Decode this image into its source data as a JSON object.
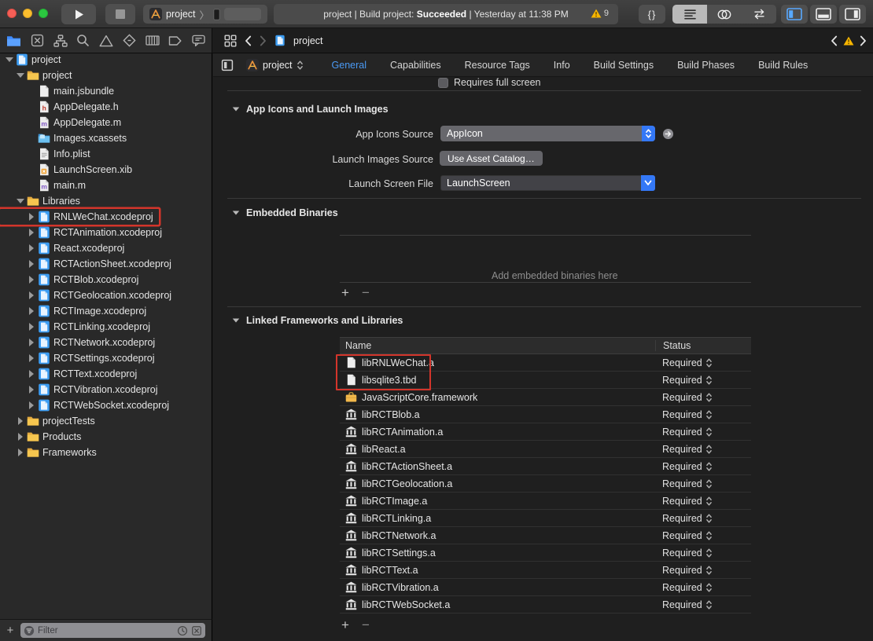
{
  "titlebar": {
    "scheme_label": "project",
    "status_left": "project | Build project: ",
    "status_bold": "Succeeded",
    "status_right": " | Yesterday at 11:38 PM",
    "warning_count": "9",
    "brace_label": "{}"
  },
  "navigator": {
    "items": [
      {
        "name": "project-navigator-icon",
        "icon": "nav-folder",
        "active": true
      },
      {
        "name": "source-control-navigator-icon",
        "icon": "nav-boxx"
      },
      {
        "name": "symbol-navigator-icon",
        "icon": "nav-org"
      },
      {
        "name": "find-navigator-icon",
        "icon": "nav-search"
      },
      {
        "name": "issue-navigator-icon",
        "icon": "nav-warn"
      },
      {
        "name": "test-navigator-icon",
        "icon": "nav-diamond"
      },
      {
        "name": "debug-navigator-icon",
        "icon": "nav-columns"
      },
      {
        "name": "breakpoint-navigator-icon",
        "icon": "nav-tag"
      },
      {
        "name": "report-navigator-icon",
        "icon": "nav-bubble"
      }
    ]
  },
  "jumpbar": {
    "file": "project"
  },
  "sidebar": {
    "filter_placeholder": "Filter",
    "items": [
      {
        "label": "project",
        "icon": "xcodeproj",
        "level": 0,
        "disc": "open"
      },
      {
        "label": "project",
        "icon": "folder",
        "level": 1,
        "disc": "open"
      },
      {
        "label": "main.jsbundle",
        "icon": "doc",
        "level": 2,
        "disc": ""
      },
      {
        "label": "AppDelegate.h",
        "icon": "doc-h",
        "level": 2,
        "disc": ""
      },
      {
        "label": "AppDelegate.m",
        "icon": "doc-m",
        "level": 2,
        "disc": ""
      },
      {
        "label": "Images.xcassets",
        "icon": "xcassets",
        "level": 2,
        "disc": ""
      },
      {
        "label": "Info.plist",
        "icon": "plist",
        "level": 2,
        "disc": ""
      },
      {
        "label": "LaunchScreen.xib",
        "icon": "xib",
        "level": 2,
        "disc": ""
      },
      {
        "label": "main.m",
        "icon": "doc-m",
        "level": 2,
        "disc": ""
      },
      {
        "label": "Libraries",
        "icon": "folder",
        "level": 1,
        "disc": "open"
      },
      {
        "label": "RNLWeChat.xcodeproj",
        "icon": "xcodeproj",
        "level": 2,
        "disc": "closed",
        "highlight": true
      },
      {
        "label": "RCTAnimation.xcodeproj",
        "icon": "xcodeproj",
        "level": 2,
        "disc": "closed"
      },
      {
        "label": "React.xcodeproj",
        "icon": "xcodeproj",
        "level": 2,
        "disc": "closed"
      },
      {
        "label": "RCTActionSheet.xcodeproj",
        "icon": "xcodeproj",
        "level": 2,
        "disc": "closed"
      },
      {
        "label": "RCTBlob.xcodeproj",
        "icon": "xcodeproj",
        "level": 2,
        "disc": "closed"
      },
      {
        "label": "RCTGeolocation.xcodeproj",
        "icon": "xcodeproj",
        "level": 2,
        "disc": "closed"
      },
      {
        "label": "RCTImage.xcodeproj",
        "icon": "xcodeproj",
        "level": 2,
        "disc": "closed"
      },
      {
        "label": "RCTLinking.xcodeproj",
        "icon": "xcodeproj",
        "level": 2,
        "disc": "closed"
      },
      {
        "label": "RCTNetwork.xcodeproj",
        "icon": "xcodeproj",
        "level": 2,
        "disc": "closed"
      },
      {
        "label": "RCTSettings.xcodeproj",
        "icon": "xcodeproj",
        "level": 2,
        "disc": "closed"
      },
      {
        "label": "RCTText.xcodeproj",
        "icon": "xcodeproj",
        "level": 2,
        "disc": "closed"
      },
      {
        "label": "RCTVibration.xcodeproj",
        "icon": "xcodeproj",
        "level": 2,
        "disc": "closed"
      },
      {
        "label": "RCTWebSocket.xcodeproj",
        "icon": "xcodeproj",
        "level": 2,
        "disc": "closed"
      },
      {
        "label": "projectTests",
        "icon": "folder",
        "level": 1,
        "disc": "closed"
      },
      {
        "label": "Products",
        "icon": "folder",
        "level": 1,
        "disc": "closed"
      },
      {
        "label": "Frameworks",
        "icon": "folder",
        "level": 1,
        "disc": "closed"
      }
    ]
  },
  "header": {
    "target": "project",
    "tabs": [
      "General",
      "Capabilities",
      "Resource Tags",
      "Info",
      "Build Settings",
      "Build Phases",
      "Build Rules"
    ],
    "selected_tab": "General"
  },
  "general": {
    "requires_full_screen": "Requires full screen",
    "app_icons": {
      "title": "App Icons and Launch Images",
      "rows": [
        {
          "label": "App Icons Source",
          "value": "AppIcon"
        },
        {
          "label": "Launch Images Source",
          "value": "Use Asset Catalog…"
        },
        {
          "label": "Launch Screen File",
          "value": "LaunchScreen"
        }
      ]
    },
    "embedded": {
      "title": "Embedded Binaries",
      "placeholder": "Add embedded binaries here"
    },
    "linked": {
      "title": "Linked Frameworks and Libraries",
      "columns": [
        "Name",
        "Status"
      ],
      "rows": [
        {
          "name": "libRNLWeChat.a",
          "icon": "doc",
          "status": "Required",
          "highlight": true
        },
        {
          "name": "libsqlite3.tbd",
          "icon": "doc",
          "status": "Required",
          "highlight": true
        },
        {
          "name": "JavaScriptCore.framework",
          "icon": "toolbox",
          "status": "Required"
        },
        {
          "name": "libRCTBlob.a",
          "icon": "bank",
          "status": "Required"
        },
        {
          "name": "libRCTAnimation.a",
          "icon": "bank",
          "status": "Required"
        },
        {
          "name": "libReact.a",
          "icon": "bank",
          "status": "Required"
        },
        {
          "name": "libRCTActionSheet.a",
          "icon": "bank",
          "status": "Required"
        },
        {
          "name": "libRCTGeolocation.a",
          "icon": "bank",
          "status": "Required"
        },
        {
          "name": "libRCTImage.a",
          "icon": "bank",
          "status": "Required"
        },
        {
          "name": "libRCTLinking.a",
          "icon": "bank",
          "status": "Required"
        },
        {
          "name": "libRCTNetwork.a",
          "icon": "bank",
          "status": "Required"
        },
        {
          "name": "libRCTSettings.a",
          "icon": "bank",
          "status": "Required"
        },
        {
          "name": "libRCTText.a",
          "icon": "bank",
          "status": "Required"
        },
        {
          "name": "libRCTVibration.a",
          "icon": "bank",
          "status": "Required"
        },
        {
          "name": "libRCTWebSocket.a",
          "icon": "bank",
          "status": "Required"
        }
      ]
    },
    "colors": {
      "accent_blue": "#3478f6",
      "tab_blue": "#4a9af5",
      "highlight_red": "#d3352b",
      "warning_yellow": "#f7b500"
    }
  }
}
